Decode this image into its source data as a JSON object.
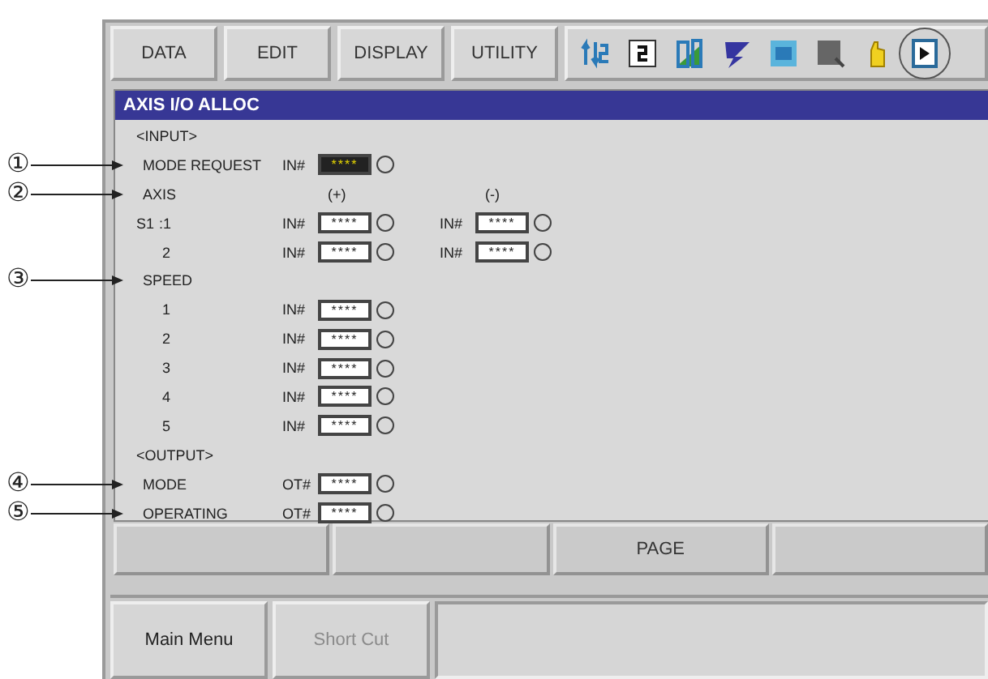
{
  "menu": [
    {
      "label": "DATA"
    },
    {
      "label": "EDIT"
    },
    {
      "label": "DISPLAY"
    },
    {
      "label": "UTILITY"
    }
  ],
  "toolbar_icons": [
    {
      "kind": "arrows",
      "circled": false
    },
    {
      "kind": "page",
      "circled": false
    },
    {
      "kind": "chart",
      "circled": false
    },
    {
      "kind": "lightning",
      "circled": false
    },
    {
      "kind": "image",
      "circled": false
    },
    {
      "kind": "document",
      "circled": false
    },
    {
      "kind": "hand",
      "circled": false
    },
    {
      "kind": "play",
      "circled": true
    }
  ],
  "window": {
    "title": "AXIS I/O ALLOC"
  },
  "rows": [
    {
      "kind": "section",
      "label": "<INPUT>"
    },
    {
      "kind": "item",
      "label": "MODE REQUEST",
      "callout": "①",
      "ports": [
        {
          "prefix": "IN#",
          "value": "****",
          "selected": true
        }
      ]
    },
    {
      "kind": "header",
      "label": "AXIS",
      "callout": "②",
      "columns": [
        "(+)",
        "(-)"
      ]
    },
    {
      "kind": "item",
      "group": "S1",
      "label": ":1",
      "ports": [
        {
          "prefix": "IN#",
          "value": "****",
          "selected": false
        },
        {
          "prefix": "IN#",
          "value": "****",
          "selected": false
        }
      ]
    },
    {
      "kind": "item",
      "label": "2",
      "ports": [
        {
          "prefix": "IN#",
          "value": "****",
          "selected": false
        },
        {
          "prefix": "IN#",
          "value": "****",
          "selected": false
        }
      ]
    },
    {
      "kind": "section",
      "label": "SPEED",
      "callout": "③"
    },
    {
      "kind": "item",
      "label": "1",
      "ports": [
        {
          "prefix": "IN#",
          "value": "****",
          "selected": false
        }
      ]
    },
    {
      "kind": "item",
      "label": "2",
      "ports": [
        {
          "prefix": "IN#",
          "value": "****",
          "selected": false
        }
      ]
    },
    {
      "kind": "item",
      "label": "3",
      "ports": [
        {
          "prefix": "IN#",
          "value": "****",
          "selected": false
        }
      ]
    },
    {
      "kind": "item",
      "label": "4",
      "ports": [
        {
          "prefix": "IN#",
          "value": "****",
          "selected": false
        }
      ]
    },
    {
      "kind": "item",
      "label": "5",
      "ports": [
        {
          "prefix": "IN#",
          "value": "****",
          "selected": false
        }
      ]
    },
    {
      "kind": "section",
      "label": "<OUTPUT>"
    },
    {
      "kind": "item",
      "label": "MODE",
      "callout": "④",
      "ports": [
        {
          "prefix": "OT#",
          "value": "****",
          "selected": false
        }
      ]
    },
    {
      "kind": "item",
      "label": "OPERATING",
      "callout": "⑤",
      "ports": [
        {
          "prefix": "OT#",
          "value": "****",
          "selected": false
        }
      ]
    }
  ],
  "function_keys": [
    {
      "kind": "blank"
    },
    {
      "kind": "blank"
    },
    {
      "kind": "labeled",
      "label": "PAGE"
    },
    {
      "kind": "blank"
    }
  ],
  "bottom_buttons": [
    {
      "label": "Main Menu",
      "disabled": false
    },
    {
      "label": "Short Cut",
      "disabled": true
    }
  ]
}
